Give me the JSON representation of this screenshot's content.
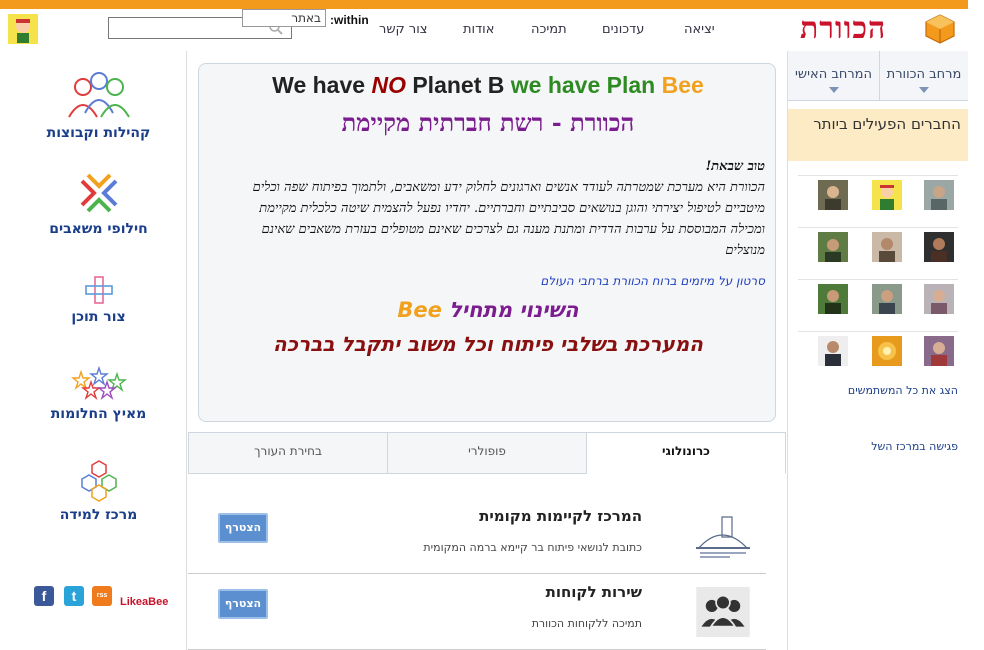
{
  "header": {
    "logo_text": "הכוורת",
    "nav": [
      "יציאה",
      "עדכונים",
      "תמיכה",
      "אודות",
      "צור קשר"
    ],
    "within_label": ":within",
    "site_select_value": "באתר",
    "search_placeholder": ""
  },
  "left_menu": [
    {
      "label": "קהילות וקבוצות",
      "icon": "people-icon"
    },
    {
      "label": "חילופי משאבים",
      "icon": "exchange-icon"
    },
    {
      "label": "צור תוכן",
      "icon": "plus-icon"
    },
    {
      "label": "מאיץ החלומות",
      "icon": "stars-icon"
    },
    {
      "label": "מרכז למידה",
      "icon": "honeycomb-icon"
    }
  ],
  "social": {
    "facebook": "f",
    "twitter": "t",
    "rss": "rss",
    "likeabee": "LikeaBee"
  },
  "hero": {
    "title_we_have": "We have",
    "title_no": "NO",
    "title_planet": "Planet B",
    "title_plan": "we have Plan",
    "title_bee": "Bee",
    "subtitle": "הכוורת - רשת חברתית מקיימת",
    "greeting": "טוב שבאת!",
    "body": "הכוורת היא מערכת שמטרתה לעודד אנשים וארגונים לחלוק ידע ומשאבים, ולתמוך בפיתוח שפה וכלים מיטביים לטיפול יצירתי והוגן בנושאים סביבתיים וחברתיים. יחדיו נפעל להצמית שיטה כלכלית מקיימת ומכילה המבוססת על ערבות הדדית ומתנת מענה גם לצרכים שאינם מטופלים בעזרת משאבים שאינם מנוצלים",
    "video_link": "סרטון על מיזמים ברוח הכוורת ברחבי העולם",
    "change_text": "השינוי מתחיל",
    "change_bee": "Bee",
    "dev_notice": "המערכת בשלבי פיתוח וכל משוב יתקבל בברכה"
  },
  "tabs": [
    "כרונולוגי",
    "פופולרי",
    "בחירת העורך"
  ],
  "groups": [
    {
      "title": "המרכז לקיימות מקומית",
      "desc": "כתובת לנושאי פיתוח בר קיימא ברמה המקומית",
      "button": "הצטרף",
      "logo": "sustainability-center-logo"
    },
    {
      "title": "שירות לקוחות",
      "desc": "תמיכה ללקוחות הכוורת",
      "button": "הצטרף",
      "logo": "users-group-icon"
    }
  ],
  "right": {
    "tab_hive_space": "מרחב הכוורת",
    "tab_personal_space": "המרחב האישי",
    "active_members_title": "החברים הפעילים ביותר",
    "show_all_users": "הצג את כל המשתמשים",
    "meeting": "פגישה במרכז השל"
  },
  "colors": {
    "accent_orange": "#f39a1c",
    "brand_red": "#c9132a",
    "purple": "#7b1d8e",
    "green": "#2e8b23",
    "link_blue": "#1b3e8a",
    "join_button": "#5b8fcf"
  }
}
